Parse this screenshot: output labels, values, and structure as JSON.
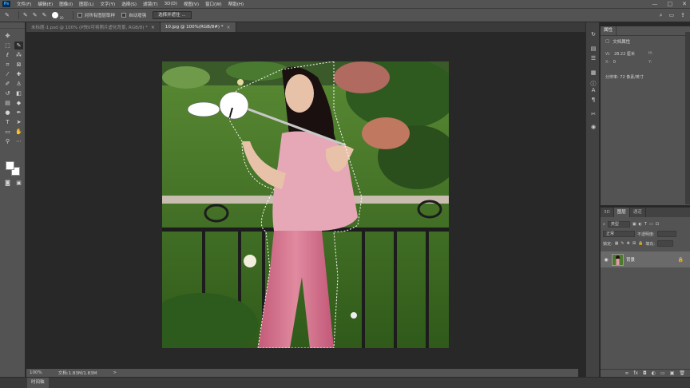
{
  "app": {
    "logo": "Ps"
  },
  "menu": [
    "文件(F)",
    "编辑(E)",
    "图像(I)",
    "图层(L)",
    "文字(Y)",
    "选择(S)",
    "滤镜(T)",
    "3D(D)",
    "视图(V)",
    "窗口(W)",
    "帮助(H)"
  ],
  "window_controls": {
    "minimize": "—",
    "maximize": "□",
    "close": "✕"
  },
  "options": {
    "brush_size": "20",
    "sample_all_layers": "对所有图层取样",
    "auto_enhance": "自动增强",
    "select_and_mask": "选择并遮住 ..."
  },
  "tabs": [
    {
      "label": "未标题-1.psd @ 100% (P快0可将照片虚化背景, RGB/8) *",
      "close": "×"
    },
    {
      "label": "10.jpg @ 100%(RGB/8#) *",
      "close": "×"
    }
  ],
  "status": {
    "zoom": "100%",
    "doc": "文档:1.83M/1.83M",
    "arrow": ">"
  },
  "timeline": {
    "tab": "时间轴"
  },
  "properties": {
    "tab": "属性",
    "doc_props": "文档属性",
    "w_label": "W:",
    "w_value": "28.22 厘米",
    "h_label": "H:",
    "x_label": "X:",
    "x_value": "0",
    "y_label": "Y:",
    "resolution": "分辨率: 72 像素/英寸"
  },
  "layers": {
    "tabs": [
      "3D",
      "图层",
      "通道"
    ],
    "kind": "类型",
    "blend": "正常",
    "opacity_label": "不透明度:",
    "lock_label": "锁定:",
    "fill_label": "填充:",
    "layer_name": "背景",
    "bottom_icons": [
      "∞",
      "fx",
      "◘",
      "◐",
      "▭",
      "▣",
      "🗑"
    ]
  }
}
